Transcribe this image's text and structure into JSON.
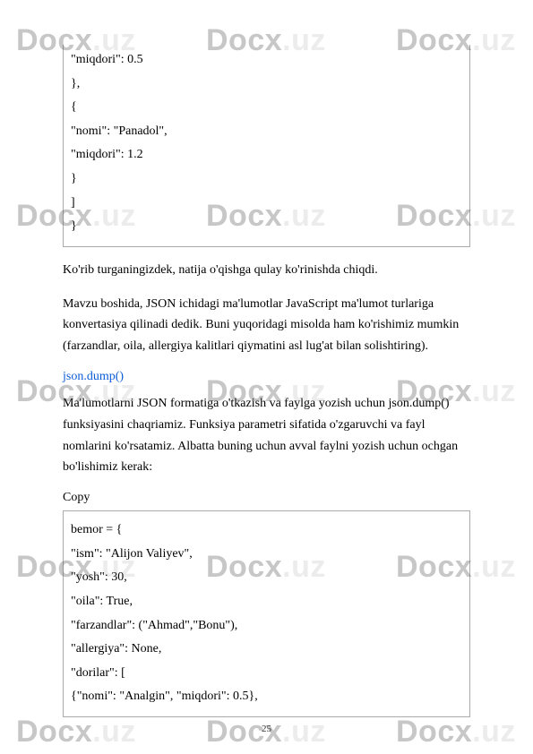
{
  "watermark": "Docx.uz",
  "code_continuation": {
    "l1": "            \"miqdori\": 0.5",
    "l2": "        },",
    "l3": "        {",
    "l4": "            \"nomi\": \"Panadol\",",
    "l5": "            \"miqdori\": 1.2",
    "l6": "        }",
    "l7": "    ]",
    "l8": "}"
  },
  "para1": "Ko'rib turganingizdek, natija o'qishga qulay ko'rinishda chiqdi.",
  "para2": "Mavzu boshida, JSON ichidagi ma'lumotlar JavaScript ma'lumot turlariga konvertasiya qilinadi dedik. Buni yuqoridagi misolda ham ko'rishimiz mumkin (farzandlar, oila, allergiya kalitlari qiymatini asl lug'at bilan solishtiring).",
  "heading": "json.dump()",
  "para3": "Ma'lumotlarni JSON formatiga o'tkazish va faylga yozish uchun json.dump() funksiyasini chaqriamiz. Funksiya parametri sifatida o'zgaruvchi va fayl nomlarini ko'rsatamiz. Albatta buning uchun avval faylni yozish uchun ochgan bo'lishimiz kerak:",
  "copy_label": "Copy",
  "code_block": {
    "l1": "bemor = {",
    "l2": "  \"ism\": \"Alijon Valiyev\",",
    "l3": "  \"yosh\": 30,",
    "l4": "  \"oila\": True,",
    "l5": "  \"farzandlar\": (\"Ahmad\",\"Bonu\"),",
    "l6": "  \"allergiya\": None,",
    "l7": "  \"dorilar\": [",
    "l8": "    {\"nomi\": \"Analgin\", \"miqdori\": 0.5},"
  },
  "page_number": "25"
}
